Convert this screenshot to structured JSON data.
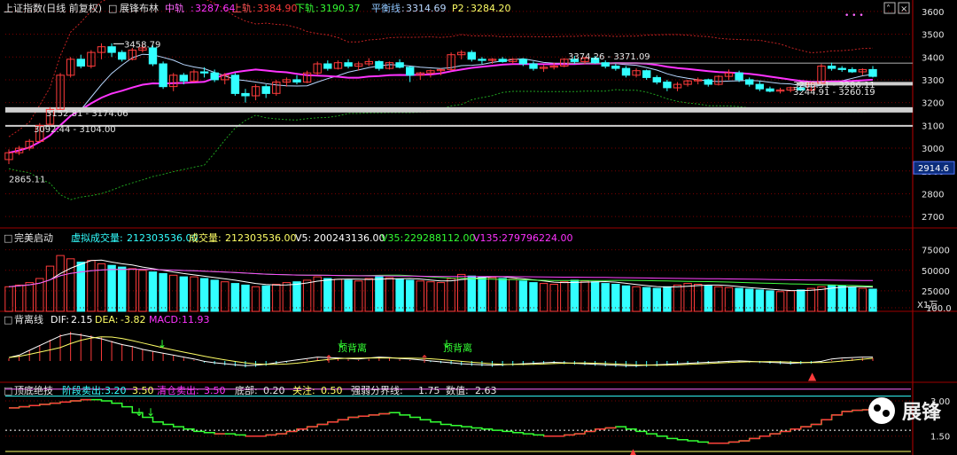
{
  "colors": {
    "up": "#ff3b3b",
    "down": "#32ffff",
    "mid": "#ff33ff",
    "upper": "#c22222",
    "lower": "#1f9f1f",
    "balance": "#b8d7ff",
    "grid": "#7a0000",
    "axis": "#9b0000",
    "text": "#e6e6e6",
    "white": "#ffffff",
    "yellow": "#ffff66",
    "green": "#33ff33"
  },
  "icons": {
    "menu": "ellipsis-icon",
    "close": "close-icon",
    "chevron": "chevron-up-icon",
    "watermark_logo": "wechat-icon"
  },
  "panel1": {
    "title": "上证指数(日线 前复权)",
    "indicator": "展锋布林",
    "mid_label": "中轨",
    "mid_value": "3287.64",
    "upper_label": "上轨",
    "upper_value": "3384.90",
    "lower_label": "下轨",
    "lower_value": "3190.37",
    "balance_label": "平衡线",
    "balance_value": "3314.69",
    "p2_label": "P2",
    "p2_value": "3284.20",
    "annotations": {
      "a1": "3458.79",
      "a2": "3374.26 - 3371.09",
      "a3": "3152.81 - 3174.06",
      "a4": "3092.44 - 3104.00",
      "a5": "2865.11",
      "a6": "3280.51 - 3286.11",
      "a7": "3244.91 - 3260.19"
    },
    "last_price_tag": "2914.6",
    "yticks": [
      "3600",
      "3500",
      "3400",
      "3300",
      "3200",
      "3100",
      "3000",
      "2900",
      "2800",
      "2700"
    ]
  },
  "panel2": {
    "title": "完美启动",
    "virtual_label": "虚拟成交量:",
    "virtual_value": "212303536.00",
    "volume_label": "成交量:",
    "volume_value": "212303536.00",
    "v5_label": "V5:",
    "v5_value": "200243136.00",
    "v35_label": "V35:",
    "v35_value": "229288112.00",
    "v135_label": "V135:",
    "v135_value": "279796224.00",
    "yticks": [
      "75000",
      "50000",
      "25000"
    ],
    "unit": "X1万"
  },
  "panel3": {
    "title": "背离线",
    "dif_label": "DIF:",
    "dif_value": "2.15",
    "dea_label": "DEA:",
    "dea_value": "-3.82",
    "macd_label": "MACD:",
    "macd_value": "11.93",
    "ytick": "100.0",
    "label_1": "顶背离",
    "label_2": "顶背离"
  },
  "panel4": {
    "title": "顶底绝技",
    "stage_sell_label": "阶段卖出:",
    "stage_sell_value": "3.20",
    "stage_sell_value2": "3.50",
    "clear_sell_label": "清仓卖出:",
    "clear_sell_value": "3.50",
    "bottom_label": "底部:",
    "bottom_value": "0.20",
    "focus_label": "关注:",
    "focus_value": "0.50",
    "strength_label": "强弱分界线:",
    "strength_value": "1.75",
    "num_label": "数值:",
    "num_value": "2.63",
    "yticks": [
      "3.00",
      "1.50"
    ]
  },
  "watermark": {
    "text": "展锋"
  },
  "chart_data": {
    "type": "candlestick",
    "ylim": [
      2650,
      3650
    ],
    "candles": [
      {
        "o": 2950,
        "h": 2995,
        "l": 2930,
        "c": 2980
      },
      {
        "o": 2980,
        "h": 3010,
        "l": 2970,
        "c": 3000
      },
      {
        "o": 3000,
        "h": 3040,
        "l": 2990,
        "c": 3030
      },
      {
        "o": 3030,
        "h": 3110,
        "l": 3030,
        "c": 3100
      },
      {
        "o": 3105,
        "h": 3180,
        "l": 3100,
        "c": 3170
      },
      {
        "o": 3170,
        "h": 3330,
        "l": 3165,
        "c": 3320
      },
      {
        "o": 3320,
        "h": 3400,
        "l": 3310,
        "c": 3390
      },
      {
        "o": 3390,
        "h": 3410,
        "l": 3350,
        "c": 3360
      },
      {
        "o": 3360,
        "h": 3430,
        "l": 3350,
        "c": 3420
      },
      {
        "o": 3420,
        "h": 3460,
        "l": 3390,
        "c": 3445
      },
      {
        "o": 3445,
        "h": 3460,
        "l": 3400,
        "c": 3420
      },
      {
        "o": 3420,
        "h": 3430,
        "l": 3380,
        "c": 3390
      },
      {
        "o": 3390,
        "h": 3440,
        "l": 3385,
        "c": 3430
      },
      {
        "o": 3430,
        "h": 3459,
        "l": 3420,
        "c": 3440
      },
      {
        "o": 3440,
        "h": 3450,
        "l": 3360,
        "c": 3370
      },
      {
        "o": 3370,
        "h": 3380,
        "l": 3260,
        "c": 3270
      },
      {
        "o": 3270,
        "h": 3330,
        "l": 3250,
        "c": 3320
      },
      {
        "o": 3320,
        "h": 3330,
        "l": 3280,
        "c": 3295
      },
      {
        "o": 3295,
        "h": 3345,
        "l": 3290,
        "c": 3335
      },
      {
        "o": 3335,
        "h": 3355,
        "l": 3310,
        "c": 3330
      },
      {
        "o": 3330,
        "h": 3345,
        "l": 3290,
        "c": 3300
      },
      {
        "o": 3300,
        "h": 3330,
        "l": 3280,
        "c": 3320
      },
      {
        "o": 3320,
        "h": 3330,
        "l": 3230,
        "c": 3240
      },
      {
        "o": 3240,
        "h": 3260,
        "l": 3200,
        "c": 3230
      },
      {
        "o": 3230,
        "h": 3280,
        "l": 3210,
        "c": 3270
      },
      {
        "o": 3270,
        "h": 3280,
        "l": 3220,
        "c": 3240
      },
      {
        "o": 3240,
        "h": 3300,
        "l": 3230,
        "c": 3290
      },
      {
        "o": 3290,
        "h": 3310,
        "l": 3270,
        "c": 3300
      },
      {
        "o": 3300,
        "h": 3320,
        "l": 3280,
        "c": 3290
      },
      {
        "o": 3290,
        "h": 3340,
        "l": 3285,
        "c": 3330
      },
      {
        "o": 3330,
        "h": 3380,
        "l": 3320,
        "c": 3370
      },
      {
        "o": 3370,
        "h": 3385,
        "l": 3340,
        "c": 3350
      },
      {
        "o": 3350,
        "h": 3385,
        "l": 3345,
        "c": 3375
      },
      {
        "o": 3375,
        "h": 3390,
        "l": 3350,
        "c": 3360
      },
      {
        "o": 3360,
        "h": 3380,
        "l": 3340,
        "c": 3370
      },
      {
        "o": 3370,
        "h": 3395,
        "l": 3360,
        "c": 3380
      },
      {
        "o": 3380,
        "h": 3385,
        "l": 3340,
        "c": 3350
      },
      {
        "o": 3350,
        "h": 3380,
        "l": 3345,
        "c": 3375
      },
      {
        "o": 3375,
        "h": 3390,
        "l": 3350,
        "c": 3355
      },
      {
        "o": 3355,
        "h": 3360,
        "l": 3290,
        "c": 3320
      },
      {
        "o": 3320,
        "h": 3335,
        "l": 3300,
        "c": 3330
      },
      {
        "o": 3330,
        "h": 3345,
        "l": 3310,
        "c": 3340
      },
      {
        "o": 3340,
        "h": 3350,
        "l": 3320,
        "c": 3345
      },
      {
        "o": 3345,
        "h": 3420,
        "l": 3340,
        "c": 3410
      },
      {
        "o": 3410,
        "h": 3430,
        "l": 3390,
        "c": 3420
      },
      {
        "o": 3420,
        "h": 3430,
        "l": 3380,
        "c": 3390
      },
      {
        "o": 3390,
        "h": 3400,
        "l": 3370,
        "c": 3385
      },
      {
        "o": 3385,
        "h": 3395,
        "l": 3370,
        "c": 3390
      },
      {
        "o": 3390,
        "h": 3400,
        "l": 3375,
        "c": 3380
      },
      {
        "o": 3380,
        "h": 3395,
        "l": 3370,
        "c": 3390
      },
      {
        "o": 3390,
        "h": 3395,
        "l": 3360,
        "c": 3370
      },
      {
        "o": 3370,
        "h": 3380,
        "l": 3340,
        "c": 3350
      },
      {
        "o": 3350,
        "h": 3365,
        "l": 3335,
        "c": 3355
      },
      {
        "o": 3355,
        "h": 3375,
        "l": 3345,
        "c": 3360
      },
      {
        "o": 3360,
        "h": 3395,
        "l": 3355,
        "c": 3390
      },
      {
        "o": 3390,
        "h": 3405,
        "l": 3370,
        "c": 3380
      },
      {
        "o": 3380,
        "h": 3400,
        "l": 3370,
        "c": 3395
      },
      {
        "o": 3395,
        "h": 3405,
        "l": 3370,
        "c": 3375
      },
      {
        "o": 3375,
        "h": 3385,
        "l": 3350,
        "c": 3360
      },
      {
        "o": 3360,
        "h": 3370,
        "l": 3340,
        "c": 3350
      },
      {
        "o": 3350,
        "h": 3360,
        "l": 3310,
        "c": 3320
      },
      {
        "o": 3320,
        "h": 3350,
        "l": 3310,
        "c": 3340
      },
      {
        "o": 3340,
        "h": 3345,
        "l": 3300,
        "c": 3310
      },
      {
        "o": 3310,
        "h": 3320,
        "l": 3280,
        "c": 3290
      },
      {
        "o": 3290,
        "h": 3300,
        "l": 3250,
        "c": 3265
      },
      {
        "o": 3265,
        "h": 3290,
        "l": 3250,
        "c": 3280
      },
      {
        "o": 3280,
        "h": 3300,
        "l": 3270,
        "c": 3295
      },
      {
        "o": 3295,
        "h": 3310,
        "l": 3280,
        "c": 3300
      },
      {
        "o": 3300,
        "h": 3305,
        "l": 3270,
        "c": 3280
      },
      {
        "o": 3280,
        "h": 3320,
        "l": 3275,
        "c": 3315
      },
      {
        "o": 3315,
        "h": 3345,
        "l": 3300,
        "c": 3330
      },
      {
        "o": 3330,
        "h": 3340,
        "l": 3290,
        "c": 3300
      },
      {
        "o": 3300,
        "h": 3310,
        "l": 3270,
        "c": 3280
      },
      {
        "o": 3280,
        "h": 3295,
        "l": 3250,
        "c": 3260
      },
      {
        "o": 3260,
        "h": 3270,
        "l": 3245,
        "c": 3250
      },
      {
        "o": 3250,
        "h": 3265,
        "l": 3240,
        "c": 3255
      },
      {
        "o": 3255,
        "h": 3270,
        "l": 3245,
        "c": 3265
      },
      {
        "o": 3265,
        "h": 3275,
        "l": 3250,
        "c": 3255
      },
      {
        "o": 3255,
        "h": 3290,
        "l": 3250,
        "c": 3285
      },
      {
        "o": 3285,
        "h": 3370,
        "l": 3280,
        "c": 3360
      },
      {
        "o": 3360,
        "h": 3375,
        "l": 3340,
        "c": 3350
      },
      {
        "o": 3350,
        "h": 3360,
        "l": 3335,
        "c": 3345
      },
      {
        "o": 3345,
        "h": 3355,
        "l": 3330,
        "c": 3335
      },
      {
        "o": 3335,
        "h": 3350,
        "l": 3320,
        "c": 3345
      },
      {
        "o": 3345,
        "h": 3360,
        "l": 3310,
        "c": 3315
      }
    ],
    "volumes": [
      30,
      32,
      35,
      40,
      55,
      68,
      64,
      60,
      62,
      58,
      56,
      54,
      52,
      50,
      48,
      46,
      44,
      42,
      42,
      40,
      38,
      36,
      34,
      32,
      30,
      31,
      33,
      35,
      36,
      38,
      42,
      40,
      39,
      38,
      37,
      40,
      42,
      41,
      39,
      38,
      37,
      36,
      35,
      40,
      45,
      43,
      42,
      41,
      40,
      39,
      37,
      35,
      34,
      33,
      36,
      38,
      37,
      36,
      34,
      33,
      31,
      30,
      29,
      28,
      30,
      32,
      34,
      33,
      31,
      30,
      29,
      28,
      27,
      26,
      25,
      24,
      25,
      26,
      28,
      30,
      32,
      31,
      29,
      28,
      27
    ],
    "macd": [
      5,
      10,
      20,
      30,
      40,
      50,
      55,
      52,
      48,
      44,
      38,
      32,
      28,
      22,
      18,
      14,
      10,
      6,
      2,
      -3,
      -6,
      -8,
      -10,
      -12,
      -11,
      -9,
      -6,
      -3,
      0,
      3,
      6,
      5,
      4,
      3,
      2,
      4,
      6,
      5,
      3,
      2,
      0,
      -2,
      -4,
      -6,
      -8,
      -9,
      -10,
      -11,
      -10,
      -9,
      -8,
      -7,
      -6,
      -5,
      -6,
      -7,
      -8,
      -9,
      -10,
      -11,
      -12,
      -12,
      -11,
      -10,
      -9,
      -8,
      -7,
      -6,
      -5,
      -4,
      -3,
      -2,
      -3,
      -4,
      -5,
      -6,
      -7,
      -6,
      -5,
      -3,
      2,
      4,
      5,
      6,
      6
    ],
    "strength": [
      2.7,
      2.75,
      2.8,
      2.85,
      2.9,
      2.95,
      3.0,
      3.05,
      3.05,
      3.0,
      2.9,
      2.75,
      2.5,
      2.3,
      2.1,
      2.0,
      1.9,
      1.8,
      1.7,
      1.65,
      1.6,
      1.6,
      1.55,
      1.5,
      1.5,
      1.55,
      1.6,
      1.7,
      1.8,
      1.9,
      2.0,
      2.1,
      2.2,
      2.3,
      2.35,
      2.4,
      2.45,
      2.5,
      2.4,
      2.3,
      2.2,
      2.1,
      2.0,
      1.95,
      1.9,
      1.85,
      1.8,
      1.75,
      1.7,
      1.65,
      1.6,
      1.55,
      1.5,
      1.5,
      1.55,
      1.6,
      1.7,
      1.8,
      1.85,
      1.9,
      1.8,
      1.7,
      1.6,
      1.5,
      1.4,
      1.35,
      1.3,
      1.25,
      1.2,
      1.2,
      1.25,
      1.3,
      1.4,
      1.5,
      1.6,
      1.7,
      1.8,
      1.9,
      2.0,
      2.2,
      2.4,
      2.55,
      2.6,
      2.62,
      2.63
    ]
  }
}
